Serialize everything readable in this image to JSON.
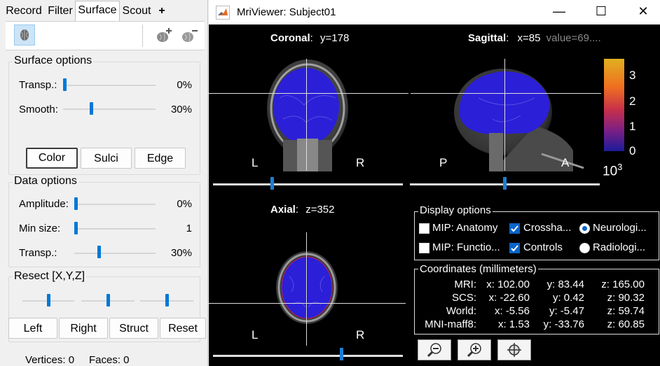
{
  "left_panel": {
    "tabs": [
      {
        "label": "Record"
      },
      {
        "label": "Filter"
      },
      {
        "label": "Surface"
      },
      {
        "label": "Scout"
      },
      {
        "label": "+"
      }
    ],
    "surface_options": {
      "title": "Surface options",
      "transp": {
        "label": "Transp.:",
        "value": "0%",
        "level": 0.0
      },
      "smooth": {
        "label": "Smooth:",
        "value": "30%",
        "level": 0.3
      },
      "buttons": {
        "color": "Color",
        "sulci": "Sulci",
        "edge": "Edge"
      }
    },
    "data_options": {
      "title": "Data options",
      "amplitude": {
        "label": "Amplitude:",
        "value": "0%",
        "level": 0.0
      },
      "min_size": {
        "label": "Min size:",
        "value": "1",
        "level": 0.0
      },
      "transp": {
        "label": "Transp.:",
        "value": "30%",
        "level": 0.3
      }
    },
    "resect": {
      "title": "Resect [X,Y,Z]",
      "levels": [
        0.5,
        0.5,
        0.5
      ],
      "buttons": {
        "left": "Left",
        "right": "Right",
        "struct": "Struct",
        "reset": "Reset"
      }
    },
    "footer": {
      "vertices": "Vertices: 0",
      "faces": "Faces: 0"
    }
  },
  "viewer": {
    "title": "MriViewer: Subject01",
    "coronal": {
      "name": "Coronal",
      "coord": "y=178",
      "left": "L",
      "right": "R"
    },
    "sagittal": {
      "name": "Sagittal",
      "coord": "x=85",
      "value": "value=69....",
      "left": "P",
      "right": "A"
    },
    "axial": {
      "name": "Axial",
      "coord": "z=352",
      "left": "L",
      "right": "R"
    },
    "colorbar": {
      "ticks": [
        "3",
        "2",
        "1",
        "0"
      ],
      "exponent": "10",
      "exponent_power": "3"
    },
    "display_options": {
      "title": "Display options",
      "items": [
        {
          "label": "MIP: Anatomy",
          "checked": false
        },
        {
          "label": "Crossha...",
          "checked": true
        },
        {
          "label": "Neurologi...",
          "checked": true
        },
        {
          "label": "MIP: Functio...",
          "checked": false
        },
        {
          "label": "Controls",
          "checked": true
        },
        {
          "label": "Radiologi...",
          "checked": false
        }
      ]
    },
    "coordinates": {
      "title": "Coordinates (millimeters)",
      "rows": [
        {
          "label": "MRI:",
          "x": "x: 102.00",
          "y": "y: 83.44",
          "z": "z: 165.00"
        },
        {
          "label": "SCS:",
          "x": "x: -22.60",
          "y": "y: 0.42",
          "z": "z: 90.32"
        },
        {
          "label": "World:",
          "x": "x: -5.56",
          "y": "y: -5.47",
          "z": "z: 59.74"
        },
        {
          "label": "MNI-maff8:",
          "x": "x: 1.53",
          "y": "y: -33.76",
          "z": "z: 60.85"
        }
      ]
    },
    "slider_levels": {
      "coronal": 0.31,
      "sagittal": 0.5,
      "axial": 0.68
    },
    "tools": [
      "zoom-out",
      "zoom-in",
      "center"
    ]
  },
  "colors": {
    "accent": "#0078d7",
    "overlay_blue": "#2b1fd8",
    "viewer_bg": "#000000"
  }
}
